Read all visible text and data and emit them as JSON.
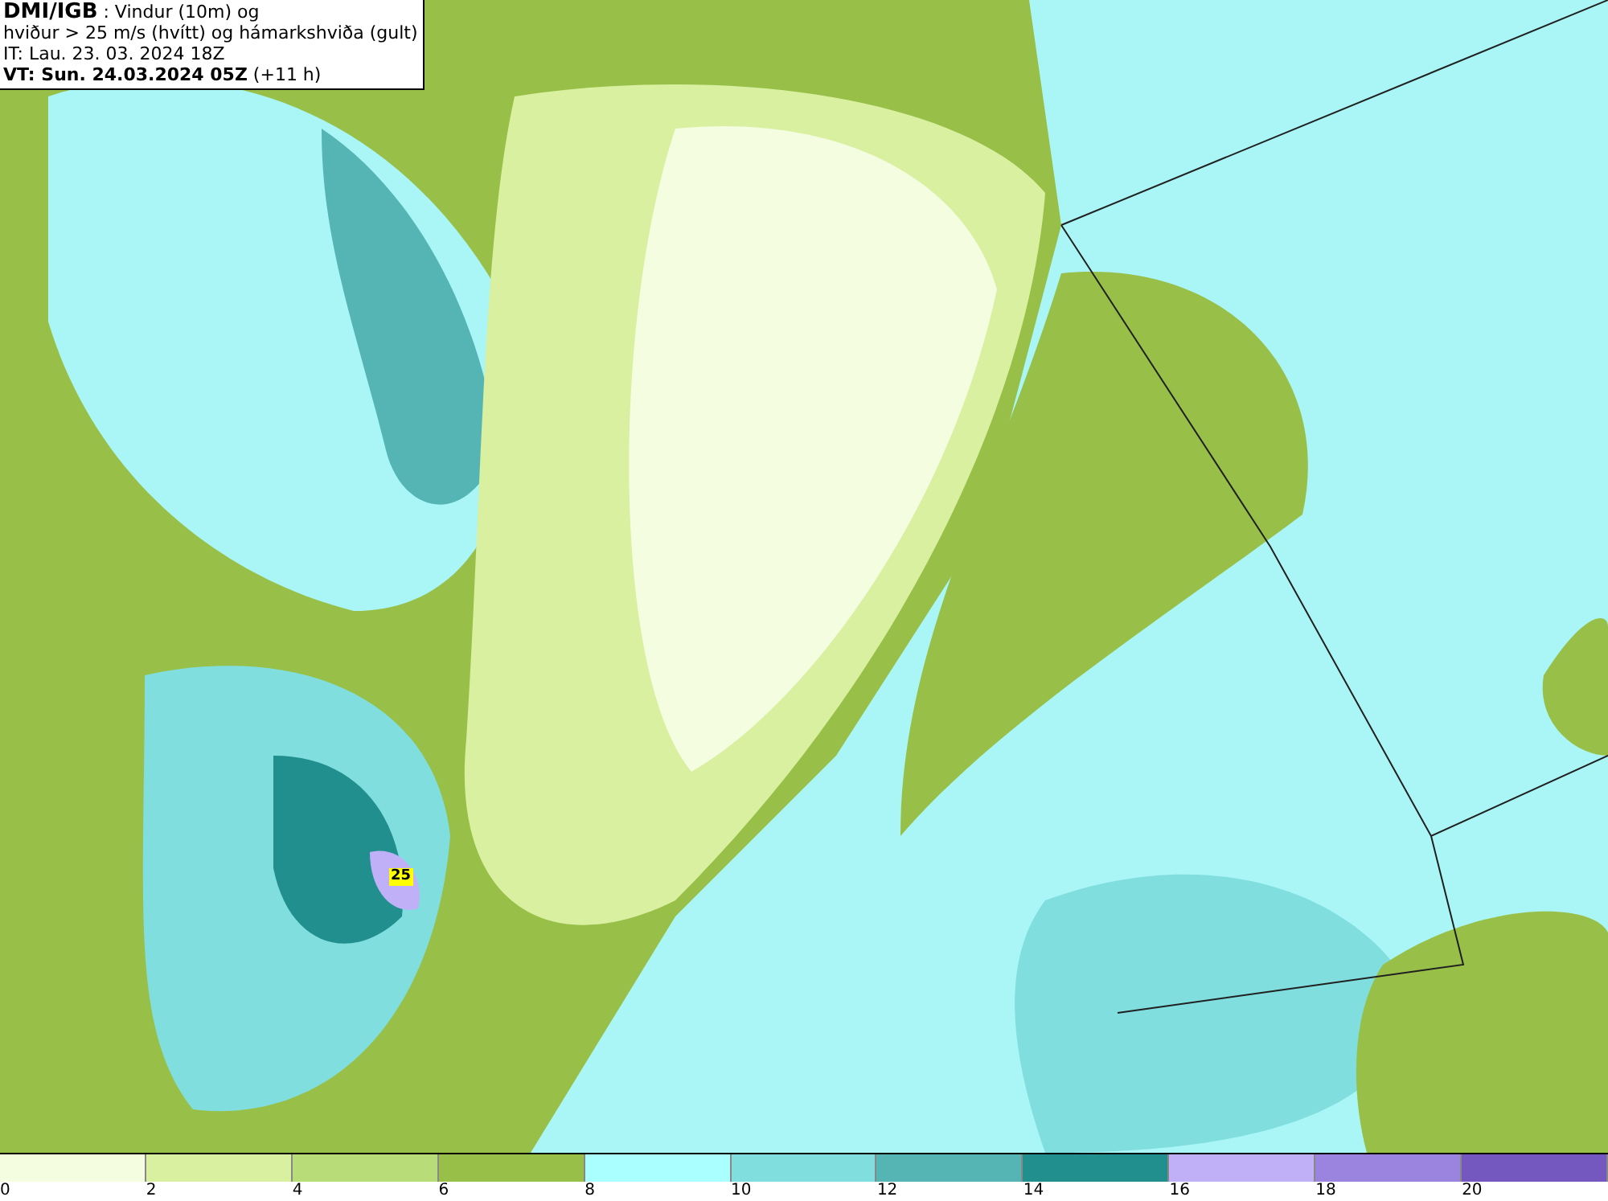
{
  "header": {
    "lines": [
      "**DMI/IGB** : Vindur (10m) og",
      "hviður > 25 m/s (hvítt) og hámarkshviða (gult)",
      "IT: Lau. 23. 03. 2024 18Z",
      "**VT: Sun. 24.03.2024 05Z** (+11 h)"
    ]
  },
  "map": {
    "gust_marker": "25"
  },
  "legend": [
    {
      "label": "0",
      "color": "#f5fde0"
    },
    {
      "label": "2",
      "color": "#d8f0a0"
    },
    {
      "label": "4",
      "color": "#b8dc78"
    },
    {
      "label": "6",
      "color": "#98c048"
    },
    {
      "label": "8",
      "color": "#aaffff"
    },
    {
      "label": "10",
      "color": "#80dede"
    },
    {
      "label": "12",
      "color": "#55b5b5"
    },
    {
      "label": "14",
      "color": "#228f8f"
    },
    {
      "label": "16",
      "color": "#c0b0f8"
    },
    {
      "label": "18",
      "color": "#9a84e0"
    },
    {
      "label": "20",
      "color": "#7458c0"
    }
  ]
}
